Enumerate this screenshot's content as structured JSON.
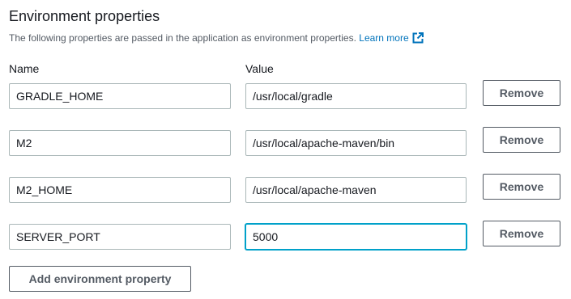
{
  "section": {
    "title": "Environment properties",
    "description": "The following properties are passed in the application as environment properties.",
    "learn_more": "Learn more",
    "learn_more_icon": "external-link-icon"
  },
  "columns": {
    "name": "Name",
    "value": "Value"
  },
  "properties": [
    {
      "name": "GRADLE_HOME",
      "value": "/usr/local/gradle",
      "remove_label": "Remove"
    },
    {
      "name": "M2",
      "value": "/usr/local/apache-maven/bin",
      "remove_label": "Remove"
    },
    {
      "name": "M2_HOME",
      "value": "/usr/local/apache-maven",
      "remove_label": "Remove"
    },
    {
      "name": "SERVER_PORT",
      "value": "5000",
      "remove_label": "Remove"
    }
  ],
  "add_button_label": "Add environment property",
  "colors": {
    "link": "#0073bb",
    "focus_border": "#00a1c9",
    "button_border": "#545b64"
  }
}
